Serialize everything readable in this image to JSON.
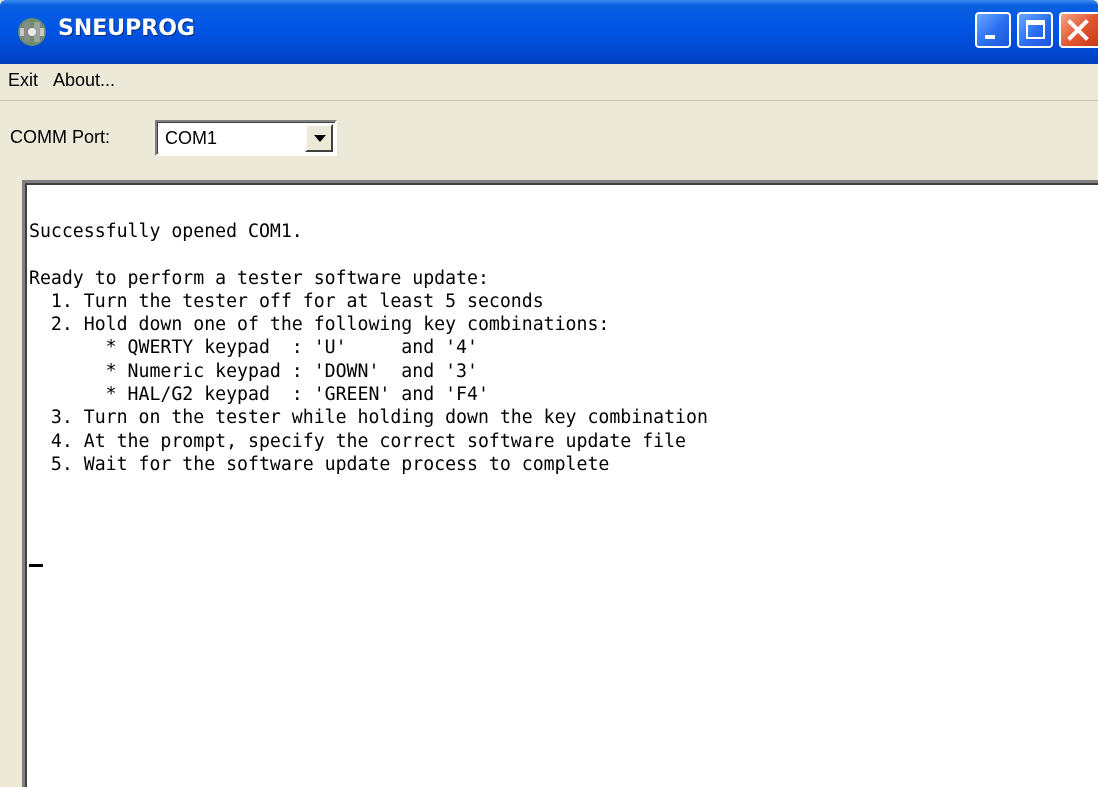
{
  "window": {
    "title": "SNEUPROG",
    "icon": "app-icon",
    "controls": [
      "minimize-icon",
      "maximize-icon",
      "close-icon"
    ]
  },
  "menu": {
    "exit": "Exit",
    "about": "About..."
  },
  "toolbar": {
    "comm_label": "COMM Port:",
    "comm_value": "COM1"
  },
  "output": {
    "lines": [
      "Successfully opened COM1.",
      "",
      "Ready to perform a tester software update:",
      "  1. Turn the tester off for at least 5 seconds",
      "  2. Hold down one of the following key combinations:",
      "       * QWERTY keypad  : 'U'     and '4'",
      "       * Numeric keypad : 'DOWN'  and '3'",
      "       * HAL/G2 keypad  : 'GREEN' and 'F4'",
      "  3. Turn on the tester while holding down the key combination",
      "  4. At the prompt, specify the correct software update file",
      "  5. Wait for the software update process to complete"
    ]
  },
  "colors": {
    "titlebar": "#0055e5",
    "window_bg": "#ece9d8",
    "close_button": "#e0542e"
  }
}
